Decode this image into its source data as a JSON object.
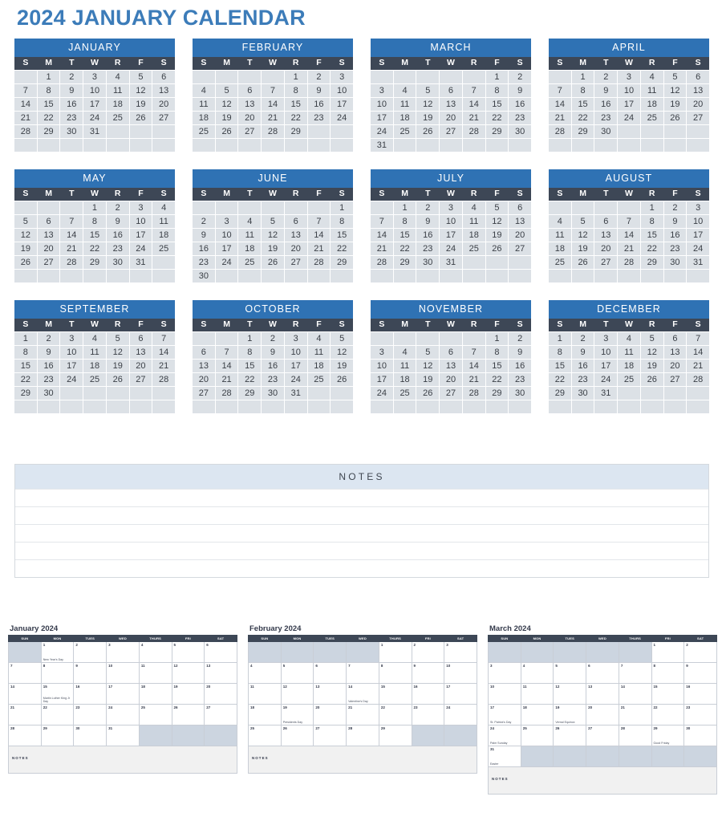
{
  "title": "2024 JANUARY CALENDAR",
  "year": "2024",
  "weekday_initials": [
    "S",
    "M",
    "T",
    "W",
    "R",
    "F",
    "S"
  ],
  "months": [
    {
      "name": "JANUARY",
      "lead": 1,
      "days": 31
    },
    {
      "name": "FEBRUARY",
      "lead": 4,
      "days": 29
    },
    {
      "name": "MARCH",
      "lead": 5,
      "days": 31
    },
    {
      "name": "APRIL",
      "lead": 1,
      "days": 30
    },
    {
      "name": "MAY",
      "lead": 3,
      "days": 31
    },
    {
      "name": "JUNE",
      "lead": 6,
      "days": 30
    },
    {
      "name": "JULY",
      "lead": 1,
      "days": 31
    },
    {
      "name": "AUGUST",
      "lead": 4,
      "days": 31
    },
    {
      "name": "SEPTEMBER",
      "lead": 0,
      "days": 30
    },
    {
      "name": "OCTOBER",
      "lead": 2,
      "days": 31
    },
    {
      "name": "NOVEMBER",
      "lead": 5,
      "days": 30
    },
    {
      "name": "DECEMBER",
      "lead": 0,
      "days": 31
    }
  ],
  "notes": {
    "header": "NOTES",
    "line_count": 5
  },
  "thumbnails": {
    "weekday_labels": [
      "SUN",
      "MON",
      "TUES",
      "WED",
      "THURS",
      "FRI",
      "SAT"
    ],
    "notes_label": "NOTES",
    "months": [
      {
        "title": "January 2024",
        "lead": 1,
        "days": 31,
        "events": {
          "1": "New Year's Day",
          "15": "Martin Luther King Jr Day"
        }
      },
      {
        "title": "February 2024",
        "lead": 4,
        "days": 29,
        "events": {
          "14": "Valentine's Day",
          "19": "Presidents Day"
        }
      },
      {
        "title": "March 2024",
        "lead": 5,
        "days": 31,
        "events": {
          "17": "St. Patrick's Day",
          "19": "Vernal Equinox",
          "24": "Palm Sunday",
          "29": "Good Friday",
          "31": "Easter"
        }
      }
    ]
  },
  "colors": {
    "title_blue": "#3c7cb9",
    "month_header_blue": "#2f72b4",
    "weekday_navy": "#3d4756",
    "day_cell": "#dce1e6",
    "notes_header": "#dce6f1",
    "thumb_shaded": "#ccd5e0"
  }
}
